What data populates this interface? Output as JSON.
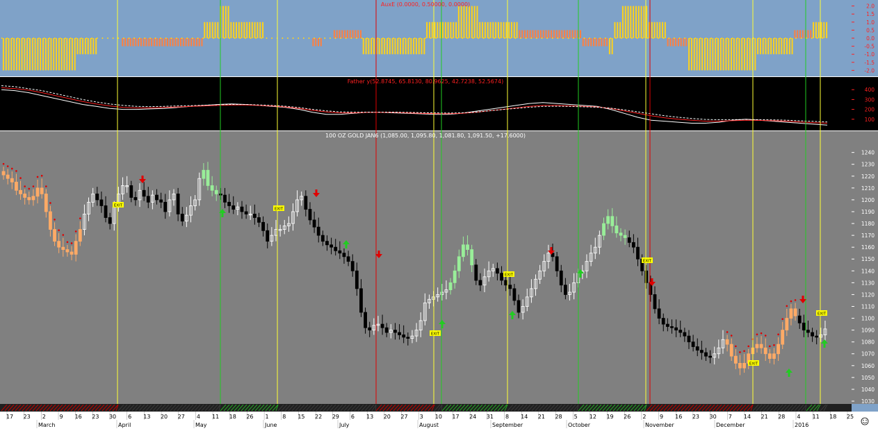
{
  "colors": {
    "aux_bg": "#7fa2c8",
    "father_bg": "#000000",
    "price_bg": "#808080",
    "axis_bg": "#ffffff",
    "yellow_bar": "#ffd21a",
    "orange_bar": "#ff8040",
    "red": "#e00000",
    "green": "#22cc22",
    "yellow_line": "#ffff33",
    "up_candle": "#ffffff",
    "down_candle": "#000000",
    "orange_candle": "#ffaa66",
    "green_candle": "#99ee99",
    "exit_label": "#ffff00"
  },
  "icons": {
    "sell_arrow": "red-down-arrow-icon",
    "buy_arrow": "green-up-arrow-icon",
    "smiley": "smiley-icon"
  },
  "panels": {
    "aux": {
      "title": "AuxE (0.0000, 0.50000, 0.0000)",
      "ticks": [
        "2.0",
        "1.5",
        "1.0",
        "0.5",
        "0.0",
        "-0.5",
        "-1.0",
        "-1.5",
        "-2.0"
      ]
    },
    "father": {
      "title": "Father y(52.8745, 65.8130, 80.9625, 42.7238, 52.5674)",
      "ticks": [
        "400",
        "300",
        "200",
        "100"
      ]
    },
    "price": {
      "title": "100 OZ GOLD JAN6 (1,085.00, 1,095.80, 1,081.80, 1,091.50, +17.6000)",
      "ticks": [
        "1240",
        "1230",
        "1220",
        "1210",
        "1200",
        "1190",
        "1180",
        "1170",
        "1160",
        "1150",
        "1140",
        "1130",
        "1120",
        "1110",
        "1100",
        "1090",
        "1080",
        "1070",
        "1060",
        "1050",
        "1040",
        "1030"
      ],
      "exit_label": "EXIT"
    }
  },
  "x_axis": {
    "day_labels": [
      "17",
      "23",
      "2",
      "9",
      "16",
      "23",
      "30",
      "6",
      "13",
      "20",
      "27",
      "4",
      "11",
      "18",
      "26",
      "1",
      "8",
      "15",
      "22",
      "29",
      "6",
      "13",
      "20",
      "27",
      "3",
      "10",
      "17",
      "24",
      "31",
      "8",
      "14",
      "21",
      "28",
      "5",
      "12",
      "19",
      "26",
      "2",
      "9",
      "16",
      "23",
      "30",
      "7",
      "14",
      "21",
      "28",
      "4",
      "11",
      "18",
      "25"
    ],
    "month_labels": [
      "March",
      "April",
      "May",
      "June",
      "July",
      "August",
      "September",
      "October",
      "November",
      "December",
      "2016"
    ]
  },
  "chart_data": [
    {
      "type": "bar",
      "name": "AuxE",
      "ylim": [
        -2.2,
        2.2
      ],
      "segments": [
        {
          "from": 1,
          "to": 28,
          "value": -2.0,
          "color": "yellow"
        },
        {
          "from": 29,
          "to": 36,
          "value": -1.0,
          "color": "yellow"
        },
        {
          "from": 46,
          "to": 76,
          "value": -0.5,
          "color": "orange"
        },
        {
          "from": 77,
          "to": 82,
          "value": 1.0,
          "color": "yellow"
        },
        {
          "from": 83,
          "to": 86,
          "value": 2.0,
          "color": "yellow"
        },
        {
          "from": 87,
          "to": 99,
          "value": 1.0,
          "color": "yellow"
        },
        {
          "from": 118,
          "to": 121,
          "value": -0.5,
          "color": "orange"
        },
        {
          "from": 126,
          "to": 136,
          "value": 0.5,
          "color": "orange"
        },
        {
          "from": 137,
          "to": 160,
          "value": -1.0,
          "color": "yellow"
        },
        {
          "from": 161,
          "to": 172,
          "value": 1.0,
          "color": "yellow"
        },
        {
          "from": 173,
          "to": 180,
          "value": 2.0,
          "color": "yellow"
        },
        {
          "from": 181,
          "to": 195,
          "value": 1.0,
          "color": "yellow"
        },
        {
          "from": 196,
          "to": 219,
          "value": 0.5,
          "color": "orange"
        },
        {
          "from": 220,
          "to": 229,
          "value": -0.5,
          "color": "orange"
        },
        {
          "from": 230,
          "to": 231,
          "value": -1.0,
          "color": "yellow"
        },
        {
          "from": 232,
          "to": 234,
          "value": 1.0,
          "color": "yellow"
        },
        {
          "from": 235,
          "to": 244,
          "value": 2.0,
          "color": "yellow"
        },
        {
          "from": 245,
          "to": 251,
          "value": 1.0,
          "color": "yellow"
        },
        {
          "from": 252,
          "to": 259,
          "value": -0.5,
          "color": "orange"
        },
        {
          "from": 260,
          "to": 285,
          "value": -2.0,
          "color": "yellow"
        },
        {
          "from": 286,
          "to": 299,
          "value": -1.0,
          "color": "yellow"
        },
        {
          "from": 300,
          "to": 306,
          "value": 0.5,
          "color": "orange"
        },
        {
          "from": 307,
          "to": 312,
          "value": 1.0,
          "color": "yellow"
        }
      ]
    },
    {
      "type": "line",
      "name": "Father y",
      "ylim": [
        0,
        500
      ],
      "series": [
        {
          "color": "#ffffff",
          "values": [
            400,
            390,
            370,
            340,
            310,
            280,
            250,
            230,
            210,
            200,
            200,
            205,
            210,
            220,
            230,
            240,
            250,
            255,
            250,
            240,
            230,
            220,
            200,
            170,
            150,
            150,
            160,
            170,
            170,
            165,
            160,
            155,
            150,
            150,
            160,
            180,
            200,
            220,
            240,
            260,
            270,
            260,
            250,
            240,
            230,
            200,
            160,
            120,
            90,
            80,
            70,
            60,
            60,
            70,
            90,
            100,
            90,
            80,
            70,
            60,
            50,
            40
          ]
        },
        {
          "color": "#ff2020",
          "values": [
            420,
            410,
            395,
            370,
            340,
            310,
            280,
            255,
            235,
            220,
            215,
            215,
            220,
            225,
            230,
            235,
            240,
            245,
            245,
            240,
            235,
            225,
            210,
            190,
            175,
            165,
            165,
            170,
            170,
            170,
            165,
            160,
            158,
            156,
            160,
            170,
            185,
            200,
            215,
            230,
            240,
            240,
            235,
            230,
            225,
            210,
            185,
            160,
            135,
            115,
            100,
            90,
            80,
            80,
            85,
            90,
            88,
            85,
            80,
            72,
            65,
            60
          ]
        },
        {
          "color": "#ffffff",
          "dashed": true,
          "values": [
            440,
            430,
            410,
            390,
            360,
            330,
            300,
            275,
            255,
            240,
            230,
            228,
            230,
            235,
            238,
            242,
            248,
            250,
            250,
            246,
            240,
            232,
            218,
            200,
            185,
            175,
            172,
            172,
            172,
            172,
            170,
            167,
            165,
            163,
            165,
            172,
            185,
            198,
            210,
            222,
            230,
            232,
            230,
            226,
            222,
            212,
            195,
            175,
            155,
            135,
            120,
            108,
            98,
            95,
            96,
            98,
            96,
            94,
            90,
            84,
            78,
            72
          ]
        }
      ]
    },
    {
      "type": "candlestick",
      "name": "100 OZ GOLD JAN6",
      "ylim": [
        1030,
        1248
      ],
      "series": [
        {
          "name": "close",
          "color_rule": "white=up, black=down, orange/green=signal zones",
          "values": [
            1221,
            1218,
            1215,
            1208,
            1205,
            1202,
            1200,
            1203,
            1210,
            1205,
            1190,
            1175,
            1165,
            1160,
            1158,
            1156,
            1154,
            1165,
            1175,
            1188,
            1198,
            1205,
            1200,
            1195,
            1185,
            1180,
            1194,
            1205,
            1212,
            1212,
            1202,
            1200,
            1208,
            1203,
            1198,
            1204,
            1200,
            1198,
            1190,
            1200,
            1205,
            1188,
            1182,
            1187,
            1195,
            1200,
            1218,
            1225,
            1212,
            1208,
            1205,
            1204,
            1198,
            1195,
            1192,
            1194,
            1190,
            1188,
            1188,
            1185,
            1181,
            1174,
            1165,
            1170,
            1175,
            1175,
            1178,
            1180,
            1190,
            1200,
            1203,
            1192,
            1183,
            1177,
            1170,
            1165,
            1162,
            1160,
            1157,
            1155,
            1152,
            1148,
            1140,
            1125,
            1105,
            1092,
            1090,
            1094,
            1095,
            1092,
            1088,
            1090,
            1088,
            1086,
            1084,
            1083,
            1085,
            1090,
            1098,
            1113,
            1116,
            1118,
            1120,
            1122,
            1124,
            1130,
            1140,
            1152,
            1162,
            1158,
            1145,
            1132,
            1128,
            1135,
            1140,
            1142,
            1138,
            1132,
            1128,
            1125,
            1115,
            1105,
            1110,
            1118,
            1125,
            1133,
            1140,
            1148,
            1155,
            1152,
            1140,
            1128,
            1120,
            1122,
            1130,
            1138,
            1140,
            1148,
            1155,
            1160,
            1170,
            1180,
            1186,
            1178,
            1172,
            1170,
            1168,
            1164,
            1160,
            1150,
            1140,
            1130,
            1120,
            1108,
            1100,
            1095,
            1093,
            1092,
            1090,
            1088,
            1085,
            1080,
            1076,
            1073,
            1071,
            1068,
            1067,
            1070,
            1075,
            1082,
            1078,
            1068,
            1062,
            1058,
            1062,
            1070,
            1075,
            1078,
            1075,
            1070,
            1066,
            1070,
            1078,
            1090,
            1100,
            1108,
            1102,
            1096,
            1090,
            1088,
            1085,
            1084,
            1086,
            1091
          ]
        }
      ],
      "signals": {
        "sell_arrows": 8,
        "buy_arrows": 7,
        "exit_labels": 7
      }
    }
  ]
}
